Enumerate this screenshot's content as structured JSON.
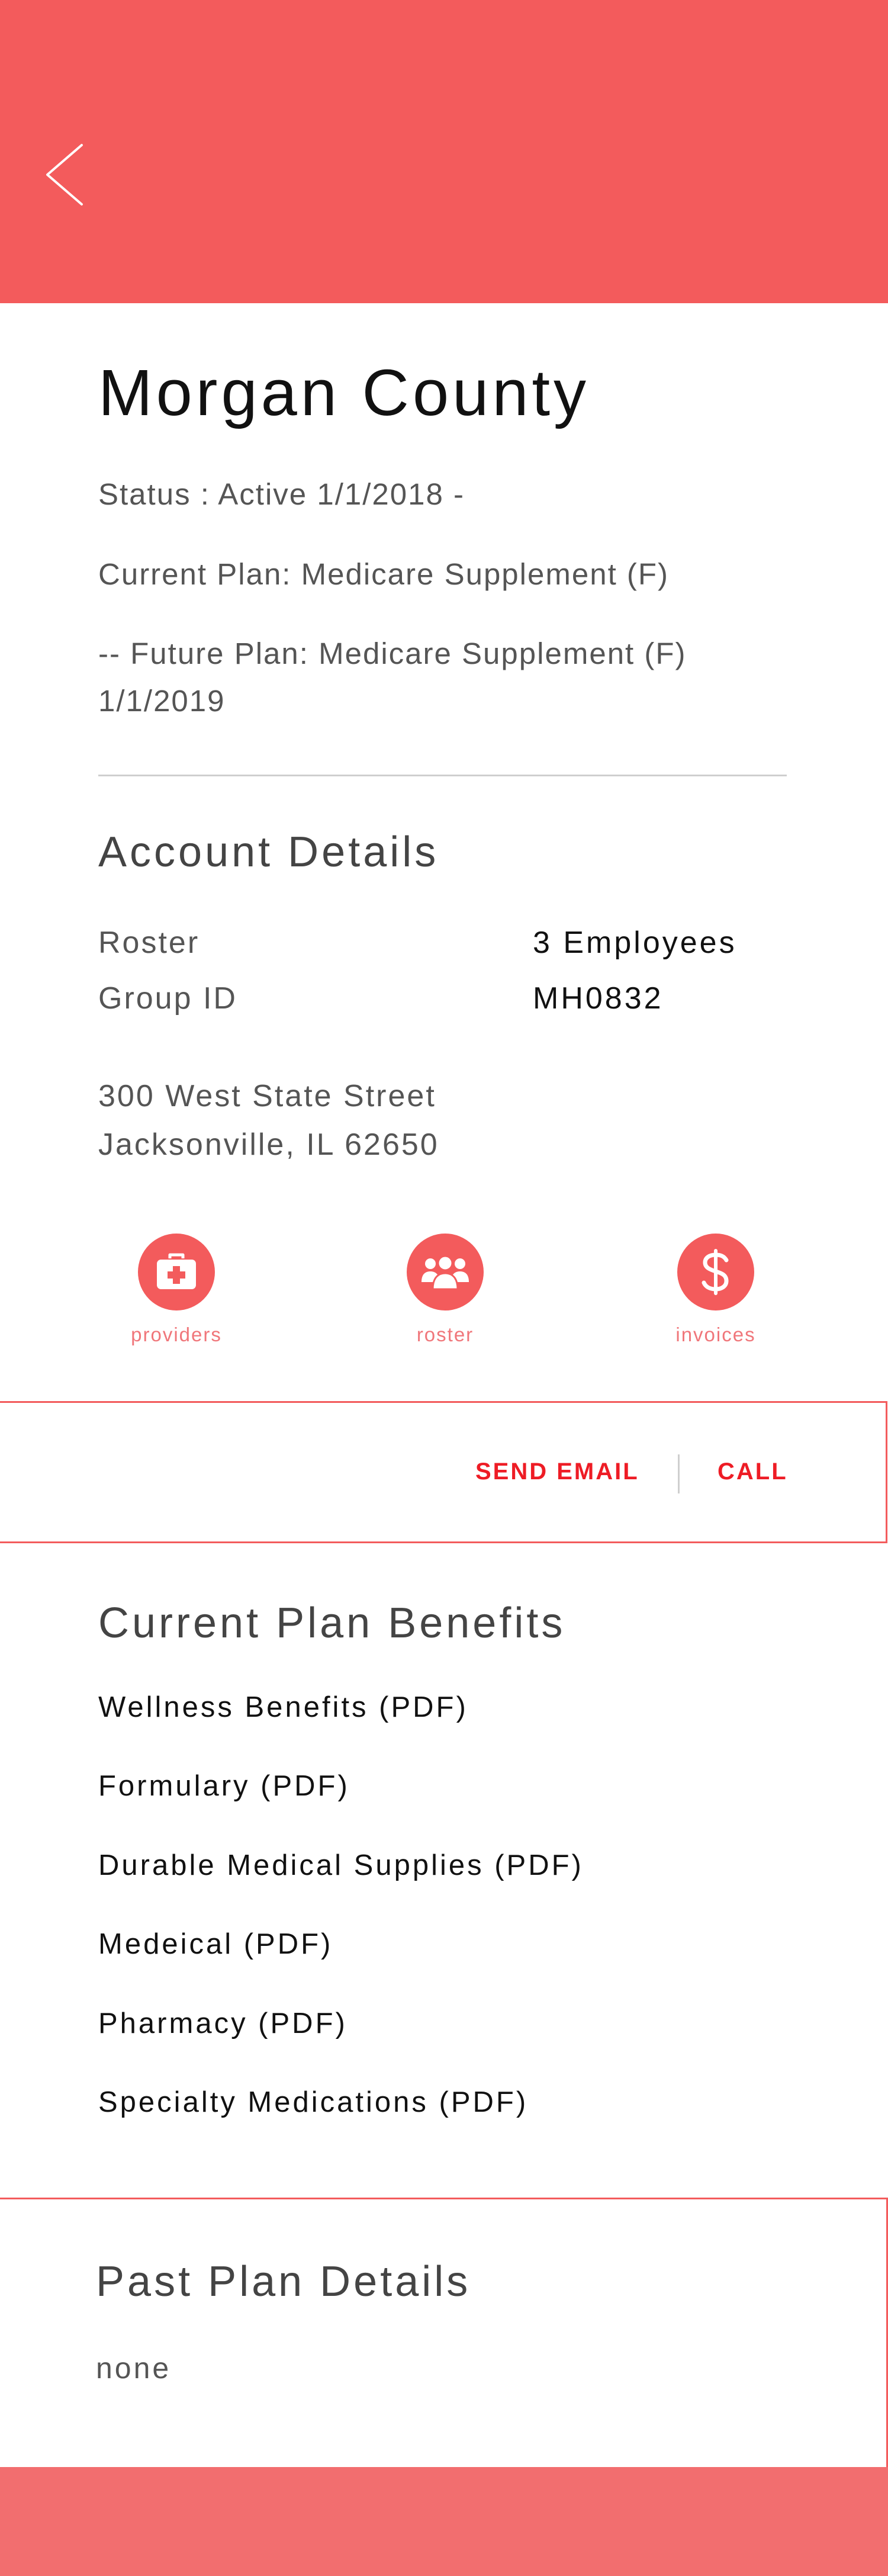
{
  "header": {
    "accent_color": "#f35b5c",
    "back_icon": "chevron-left-icon"
  },
  "account": {
    "name": "Morgan County",
    "status": "Status : Active 1/1/2018 -",
    "current_plan": "Current Plan: Medicare Supplement (F)",
    "future_plan_line1": "-- Future Plan: Medicare Supplement (F)",
    "future_plan_line2": "1/1/2019"
  },
  "account_details": {
    "title": "Account Details",
    "roster_label": "Roster",
    "roster_value": "3 Employees",
    "group_id_label": "Group ID",
    "group_id_value": "MH0832",
    "address_line1": "300 West State Street",
    "address_line2": "Jacksonville, IL 62650"
  },
  "actions": [
    {
      "label": "providers",
      "icon": "medical-kit-icon"
    },
    {
      "label": "roster",
      "icon": "people-icon"
    },
    {
      "label": "invoices",
      "icon": "dollar-icon"
    }
  ],
  "contact": {
    "email_label": "SEND EMAIL",
    "call_label": "CALL",
    "link_color": "#ee1c25"
  },
  "benefits": {
    "title": "Current Plan Benefits",
    "items": [
      "Wellness Benefits (PDF)",
      "Formulary (PDF)",
      "Durable Medical Supplies (PDF)",
      "Medeical (PDF)",
      "Pharmacy (PDF)",
      "Specialty Medications (PDF)"
    ]
  },
  "past_plan": {
    "title": "Past Plan Details",
    "value": "none"
  }
}
